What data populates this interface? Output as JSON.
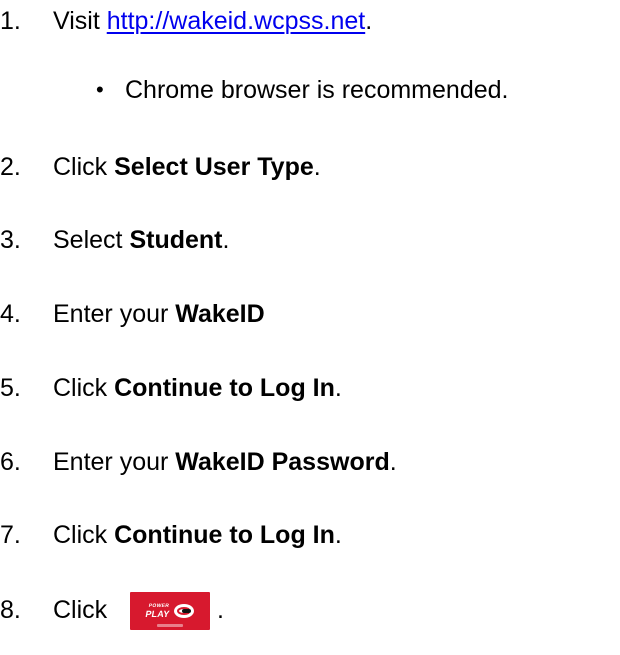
{
  "steps": [
    {
      "number": "1.",
      "prefix": "Visit ",
      "link": "http://wakeid.wcpss.net",
      "suffix": "."
    },
    {
      "bullet": "•",
      "text": "Chrome browser is recommended."
    },
    {
      "number": "2.",
      "prefix": "Click ",
      "bold": "Select User Type",
      "suffix": "."
    },
    {
      "number": "3.",
      "prefix": "Select ",
      "bold": "Student",
      "suffix": "."
    },
    {
      "number": "4.",
      "prefix": "Enter your ",
      "bold": "WakeID",
      "suffix": ""
    },
    {
      "number": "5.",
      "prefix": "Click ",
      "bold": "Continue to Log In",
      "suffix": "."
    },
    {
      "number": "6.",
      "prefix": "Enter your ",
      "bold": "WakeID Password",
      "suffix": "."
    },
    {
      "number": "7.",
      "prefix": "Click ",
      "bold": "Continue to Log In",
      "suffix": "."
    },
    {
      "number": "8.",
      "prefix": "Click ",
      "icon": "power-play-app-icon",
      "icon_text_line1": "POWER",
      "icon_text_line2": "PLAY",
      "suffix": "."
    }
  ],
  "colors": {
    "text": "#000000",
    "link": "#0000ee",
    "icon_background": "#d7192e"
  }
}
